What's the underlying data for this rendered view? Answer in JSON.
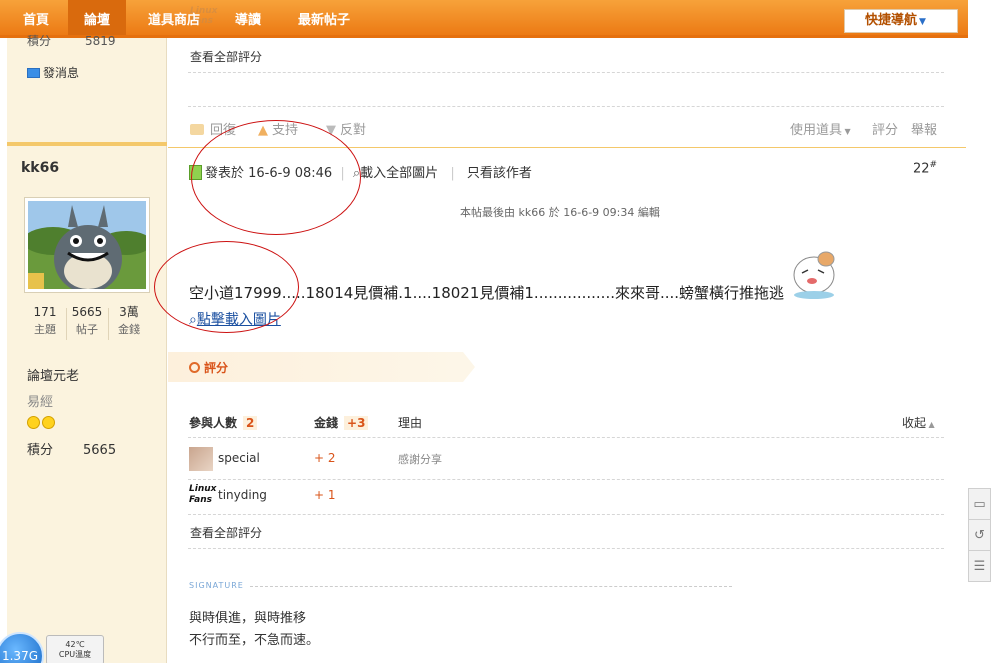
{
  "nav": {
    "items": [
      "首頁",
      "論壇",
      "道具商店",
      "導讀",
      "最新帖子"
    ],
    "quick_nav": "快捷導航",
    "ghost_logo": "Linux Fans"
  },
  "sidebar": {
    "prev_score_label": "積分",
    "prev_score_value": "5819",
    "send_message": "發消息",
    "username": "kk66",
    "stats": [
      {
        "value": "171",
        "label": "主題"
      },
      {
        "value": "5665",
        "label": "帖子"
      },
      {
        "value": "3萬",
        "label": "金錢"
      }
    ],
    "rank": "論壇元老",
    "level": "易經",
    "score_label": "積分",
    "score_value": "5665"
  },
  "prev_post": {
    "view_all_ratings": "查看全部評分",
    "actions": [
      "回復",
      "支持",
      "反對"
    ],
    "right_actions": [
      "使用道具",
      "評分",
      "舉報"
    ]
  },
  "post": {
    "posted_at": "發表於 16-6-9 08:46",
    "load_images": "載入全部圖片",
    "author_only": "只看該作者",
    "floor": "22",
    "floor_mark": "#",
    "edit_note": "本帖最後由 kk66 於 16-6-9 09:34 編輯",
    "body": "空小道17999.....18014見價補.1....18021見價補1.................來來哥....螃蟹橫行推拖逃",
    "click_load_image": "點擊載入圖片"
  },
  "rating": {
    "section_title": "評分",
    "head_participants": "參與人數",
    "participants_count": "2",
    "head_money": "金錢",
    "money_total": "+3",
    "head_reason": "理由",
    "collapse": "收起",
    "rows": [
      {
        "user": "special",
        "money": "+ 2",
        "reason": "感謝分享"
      },
      {
        "user": "tinyding",
        "money": "+ 1",
        "reason": ""
      }
    ],
    "view_all": "查看全部評分"
  },
  "signature": {
    "label": "SIGNATURE",
    "line1": "與時俱進，與時推移",
    "line2": "不行而至，不急而速。"
  },
  "widget": {
    "memory": "1.37G",
    "temp": "42℃",
    "cpu": "CPU溫度"
  },
  "colors": {
    "nav_orange": "#ec7a14",
    "annotation_red": "#cc1111",
    "link_blue": "#1a4fa0"
  }
}
